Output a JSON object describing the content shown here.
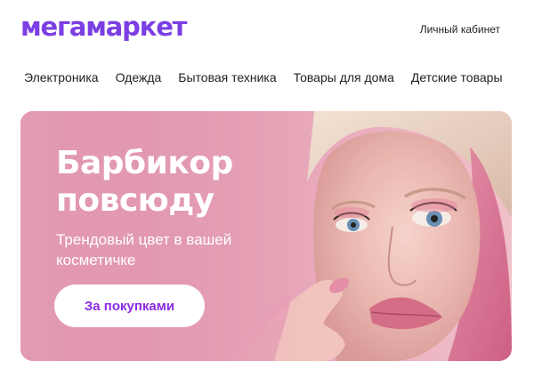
{
  "header": {
    "logo_text": "мегамаркет",
    "account_link": "Личный кабинет"
  },
  "nav": {
    "items": [
      {
        "label": "Электроника"
      },
      {
        "label": "Одежда"
      },
      {
        "label": "Бытовая техника"
      },
      {
        "label": "Товары для дома"
      },
      {
        "label": "Детские товары"
      }
    ]
  },
  "banner": {
    "title_line1": "Барбикор",
    "title_line2": "повсюду",
    "subtitle_line1": "Трендовый цвет в вашей",
    "subtitle_line2": "косметичке",
    "cta_label": "За покупками"
  },
  "colors": {
    "brand": "#7b3fe4",
    "banner_bg": "#e39bb1",
    "cta_text": "#8a2be2"
  }
}
